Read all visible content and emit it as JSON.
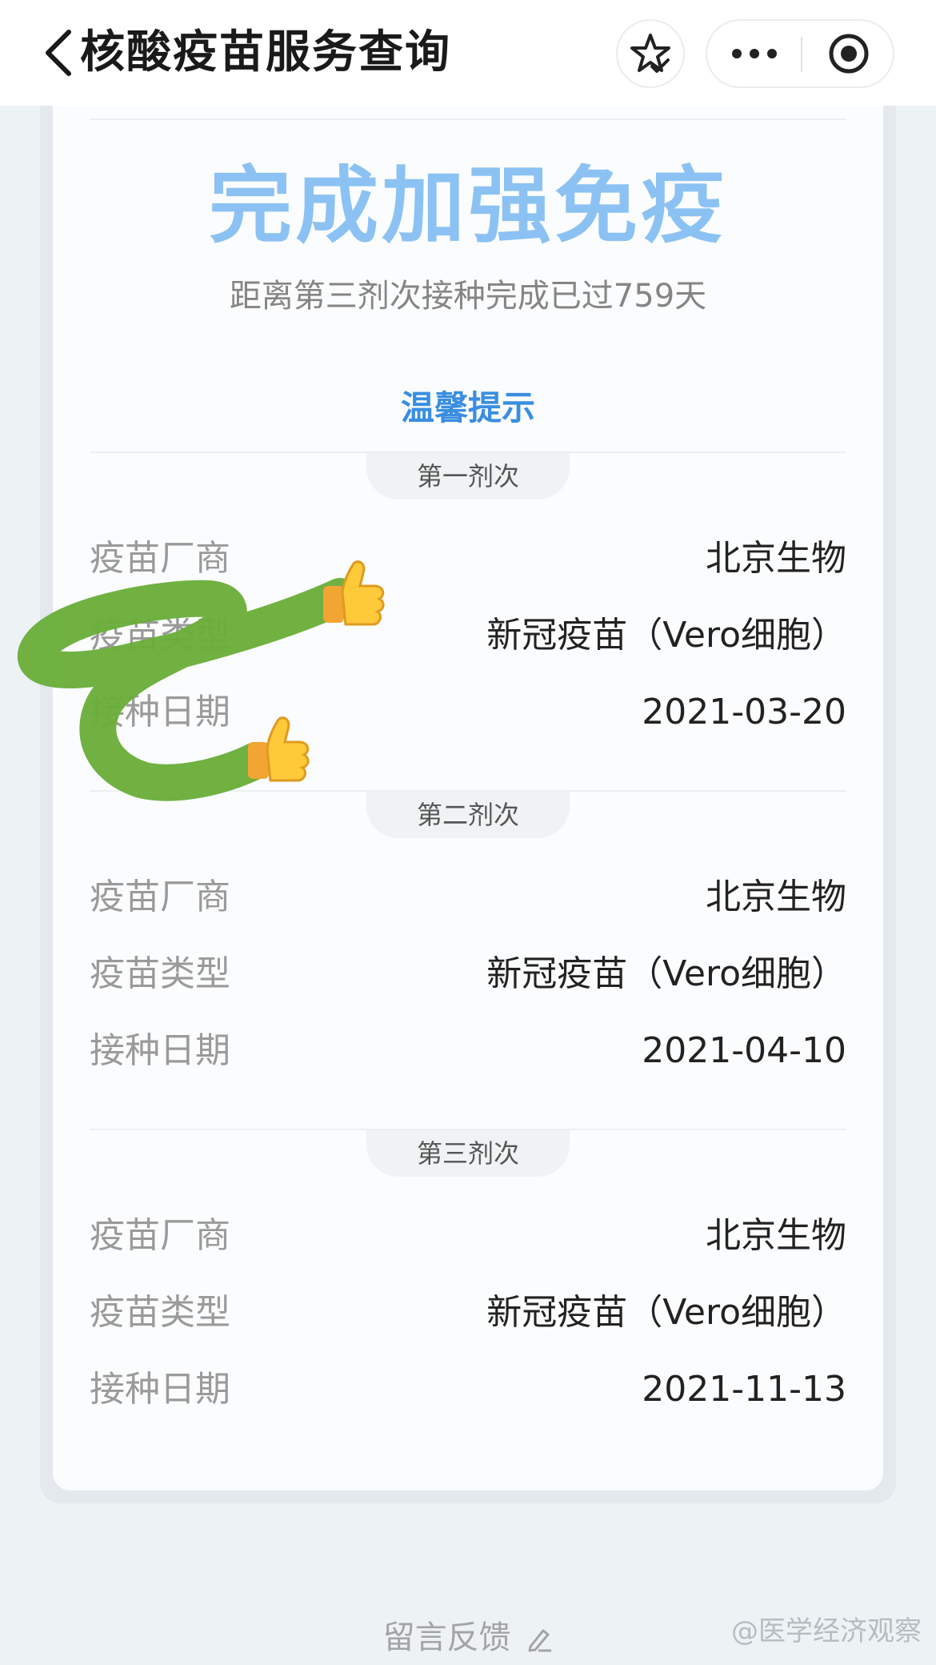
{
  "header": {
    "title": "核酸疫苗服务查询",
    "back_icon": "chevron-left-icon",
    "favorite_icon": "star-check-icon",
    "more_icon": "more-dots-icon",
    "close_icon": "record-target-icon"
  },
  "status": {
    "title": "完成加强免疫",
    "subtitle": "距离第三剂次接种完成已过759天",
    "tip_link": "温馨提示"
  },
  "colors": {
    "status_title": "#8bc2f3",
    "tip_link": "#3a8ee0",
    "doodle": "#6aae3a"
  },
  "doses": [
    {
      "heading": "第一剂次",
      "rows": [
        {
          "label": "疫苗厂商",
          "value": "北京生物"
        },
        {
          "label": "疫苗类型",
          "value": "新冠疫苗（Vero细胞）"
        },
        {
          "label": "接种日期",
          "value": "2021-03-20"
        }
      ]
    },
    {
      "heading": "第二剂次",
      "rows": [
        {
          "label": "疫苗厂商",
          "value": "北京生物"
        },
        {
          "label": "疫苗类型",
          "value": "新冠疫苗（Vero细胞）"
        },
        {
          "label": "接种日期",
          "value": "2021-04-10"
        }
      ]
    },
    {
      "heading": "第三剂次",
      "rows": [
        {
          "label": "疫苗厂商",
          "value": "北京生物"
        },
        {
          "label": "疫苗类型",
          "value": "新冠疫苗（Vero细胞）"
        },
        {
          "label": "接种日期",
          "value": "2021-11-13"
        }
      ]
    }
  ],
  "footer": {
    "feedback": "留言反馈",
    "feedback_icon": "pencil-icon",
    "watermark": "@医学经济观察"
  },
  "decoration": {
    "sticker_icon": "thumbs-up-icon"
  }
}
